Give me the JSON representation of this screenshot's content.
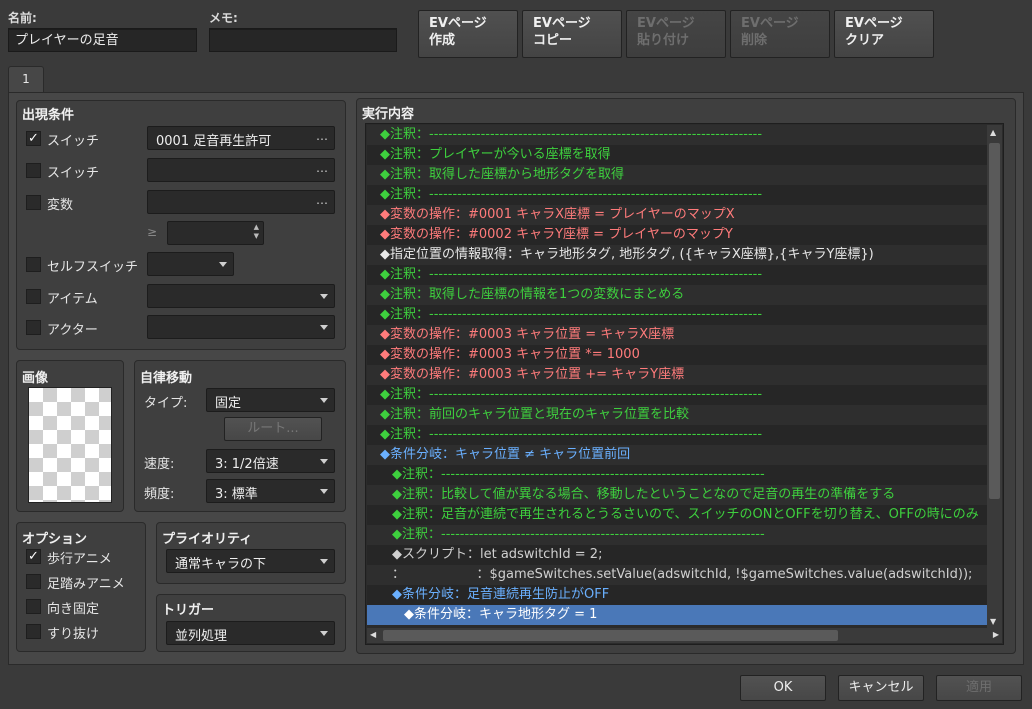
{
  "header": {
    "name_label": "名前:",
    "name_value": "プレイヤーの足音",
    "memo_label": "メモ:",
    "memo_value": "",
    "buttons": [
      {
        "line1": "EVページ",
        "line2": "作成",
        "enabled": true
      },
      {
        "line1": "EVページ",
        "line2": "コピー",
        "enabled": true
      },
      {
        "line1": "EVページ",
        "line2": "貼り付け",
        "enabled": false
      },
      {
        "line1": "EVページ",
        "line2": "削除",
        "enabled": false
      },
      {
        "line1": "EVページ",
        "line2": "クリア",
        "enabled": true
      }
    ]
  },
  "tab": {
    "label": "1"
  },
  "conditions": {
    "title": "出現条件",
    "switch1": {
      "label": "スイッチ",
      "checked": true,
      "value": "0001 足音再生許可"
    },
    "switch2": {
      "label": "スイッチ",
      "checked": false,
      "value": ""
    },
    "variable": {
      "label": "変数",
      "checked": false,
      "value": "",
      "ge": "≥",
      "number": ""
    },
    "self_switch": {
      "label": "セルフスイッチ",
      "checked": false,
      "value": ""
    },
    "item": {
      "label": "アイテム",
      "checked": false,
      "value": ""
    },
    "actor": {
      "label": "アクター",
      "checked": false,
      "value": ""
    },
    "dots": "…"
  },
  "image": {
    "title": "画像"
  },
  "movement": {
    "title": "自律移動",
    "type_label": "タイプ:",
    "type_value": "固定",
    "route_button": "ルート...",
    "speed_label": "速度:",
    "speed_value": "3: 1/2倍速",
    "freq_label": "頻度:",
    "freq_value": "3: 標準"
  },
  "options": {
    "title": "オプション",
    "items": [
      {
        "label": "歩行アニメ",
        "checked": true
      },
      {
        "label": "足踏みアニメ",
        "checked": false
      },
      {
        "label": "向き固定",
        "checked": false
      },
      {
        "label": "すり抜け",
        "checked": false
      }
    ]
  },
  "priority": {
    "title": "プライオリティ",
    "value": "通常キャラの下"
  },
  "trigger": {
    "title": "トリガー",
    "value": "並列処理"
  },
  "contents": {
    "title": "実行内容",
    "lines": [
      {
        "indent": 0,
        "color": "green",
        "text": "◆注釈：-----------------------------------------------------------------------"
      },
      {
        "indent": 0,
        "color": "green",
        "text": "◆注釈：プレイヤーが今いる座標を取得"
      },
      {
        "indent": 0,
        "color": "green",
        "text": "◆注釈：取得した座標から地形タグを取得"
      },
      {
        "indent": 0,
        "color": "green",
        "text": "◆注釈：-----------------------------------------------------------------------"
      },
      {
        "indent": 0,
        "color": "red",
        "text": "◆変数の操作：#0001 キャラX座標 = プレイヤーのマップX"
      },
      {
        "indent": 0,
        "color": "red",
        "text": "◆変数の操作：#0002 キャラY座標 = プレイヤーのマップY"
      },
      {
        "indent": 0,
        "color": "white",
        "text": "◆指定位置の情報取得：キャラ地形タグ, 地形タグ, ({キャラX座標},{キャラY座標})"
      },
      {
        "indent": 0,
        "color": "green",
        "text": "◆注釈：-----------------------------------------------------------------------"
      },
      {
        "indent": 0,
        "color": "green",
        "text": "◆注釈：取得した座標の情報を1つの変数にまとめる"
      },
      {
        "indent": 0,
        "color": "green",
        "text": "◆注釈：-----------------------------------------------------------------------"
      },
      {
        "indent": 0,
        "color": "red",
        "text": "◆変数の操作：#0003 キャラ位置 = キャラX座標"
      },
      {
        "indent": 0,
        "color": "red",
        "text": "◆変数の操作：#0003 キャラ位置 *= 1000"
      },
      {
        "indent": 0,
        "color": "red",
        "text": "◆変数の操作：#0003 キャラ位置 += キャラY座標"
      },
      {
        "indent": 0,
        "color": "green",
        "text": "◆注釈：-----------------------------------------------------------------------"
      },
      {
        "indent": 0,
        "color": "green",
        "text": "◆注釈：前回のキャラ位置と現在のキャラ位置を比較"
      },
      {
        "indent": 0,
        "color": "green",
        "text": "◆注釈：-----------------------------------------------------------------------"
      },
      {
        "indent": 0,
        "color": "blue",
        "text": "◆条件分岐：キャラ位置 ≠ キャラ位置前回"
      },
      {
        "indent": 1,
        "color": "green",
        "text": "◆注釈：---------------------------------------------------------------------"
      },
      {
        "indent": 1,
        "color": "green",
        "text": "◆注釈：比較して値が異なる場合、移動したということなので足音の再生の準備をする"
      },
      {
        "indent": 1,
        "color": "green",
        "text": "◆注釈：足音が連続で再生されるとうるさいので、スイッチのONとOFFを切り替え、OFFの時にのみ"
      },
      {
        "indent": 1,
        "color": "green",
        "text": "◆注釈：---------------------------------------------------------------------"
      },
      {
        "indent": 1,
        "color": "gray",
        "text": "◆スクリプト：let adswitchId = 2;"
      },
      {
        "indent": 1,
        "color": "gray",
        "text": "：　　　　　　：$gameSwitches.setValue(adswitchId, !$gameSwitches.value(adswitchId));"
      },
      {
        "indent": 1,
        "color": "blue",
        "text": "◆条件分岐：足音連続再生防止がOFF"
      },
      {
        "indent": 2,
        "color": "white",
        "text": "◆条件分岐：キャラ地形タグ = 1",
        "selected": true
      }
    ]
  },
  "footer": {
    "ok": "OK",
    "cancel": "キャンセル",
    "apply": "適用"
  }
}
